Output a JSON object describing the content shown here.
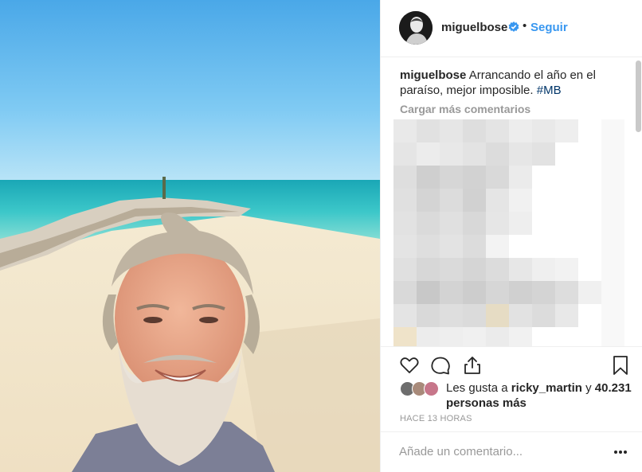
{
  "post": {
    "username": "miguelbose",
    "verified": true,
    "separator": "•",
    "follow_label": "Seguir",
    "caption_user": "miguelbose",
    "caption_text": "Arrancando el año en el paraíso, mejor imposible.",
    "caption_hashtag": "#MB",
    "load_more_label": "Cargar más comentarios",
    "likes_prefix": "Les gusta a",
    "likes_user": "ricky_martin",
    "likes_join": "y",
    "likes_count": "40.231 personas más",
    "timestamp": "HACE 13 HORAS",
    "comment_placeholder": "Añade un comentario..."
  },
  "icons": {
    "like": "heart-icon",
    "comment": "comment-icon",
    "share": "share-icon",
    "save": "bookmark-icon",
    "options": "more-options-icon",
    "verified": "verified-badge-icon"
  },
  "colors": {
    "link": "#3897f0",
    "hashtag": "#003569",
    "muted": "#999999",
    "text": "#262626"
  }
}
